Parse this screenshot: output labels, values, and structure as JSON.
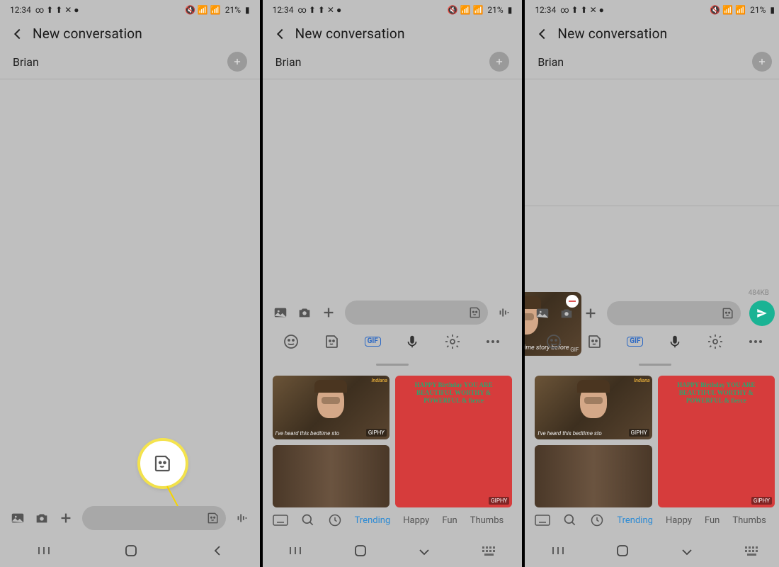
{
  "status": {
    "time": "12:34",
    "battery": "21%"
  },
  "header": {
    "title": "New conversation"
  },
  "recipient": {
    "name": "Brian"
  },
  "attachment": {
    "size": "484KB",
    "caption": "I've heard this bedtime story before",
    "tag": "GIF"
  },
  "gif_label": "GIF",
  "giphy": "GIPHY",
  "gifs": {
    "indy_title": "Indiana",
    "indy_caption": "I've heard this bedtime sto"
  },
  "categories": [
    "Trending",
    "Happy",
    "Fun",
    "Thumbs"
  ]
}
